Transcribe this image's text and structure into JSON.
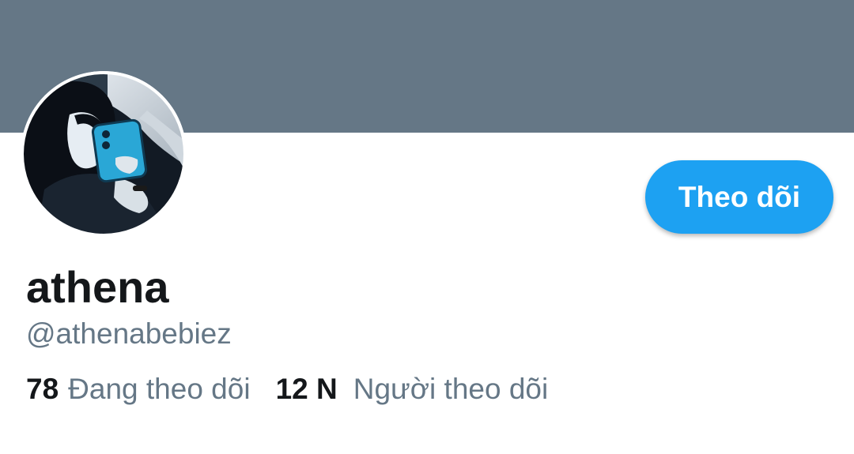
{
  "profile": {
    "display_name": "athena",
    "handle": "@athenabebiez",
    "follow_button_label": "Theo dõi",
    "following_count": "78",
    "following_label": "Đang theo dõi",
    "followers_count": "12 N",
    "followers_label": "Người theo dõi"
  },
  "colors": {
    "banner": "#657786",
    "accent": "#1da1f2",
    "text_primary": "#14171a",
    "text_secondary": "#657786"
  },
  "icons": {
    "avatar": "profile-photo"
  }
}
